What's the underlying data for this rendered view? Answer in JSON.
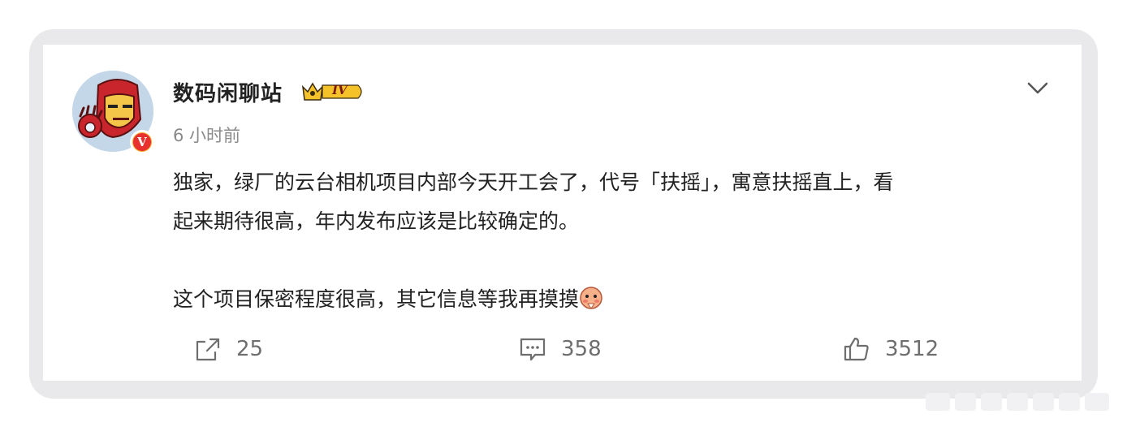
{
  "post": {
    "username": "数码闲聊站",
    "level": "IV",
    "timestamp": "6 小时前",
    "content_line1": "独家，绿厂的云台相机项目内部今天开工会了，代号「扶摇」，寓意扶摇直上，看",
    "content_line2": "起来期待很高，年内发布应该是比较确定的。",
    "content_line3": "这个项目保密程度很高，其它信息等我再摸摸",
    "verified_mark": "V"
  },
  "actions": {
    "repost_count": "25",
    "comment_count": "358",
    "like_count": "3512"
  },
  "icons": {
    "repost": "share-icon",
    "comment": "comment-icon",
    "like": "thumbs-up-icon",
    "menu": "chevron-down-icon",
    "emoji": "shy-face-emoji-icon"
  },
  "colors": {
    "frame": "#e9e9ec",
    "verified_orange": "#f5a623",
    "verified_red": "#e8312f",
    "text": "#222222",
    "muted": "#8a8a8a"
  }
}
